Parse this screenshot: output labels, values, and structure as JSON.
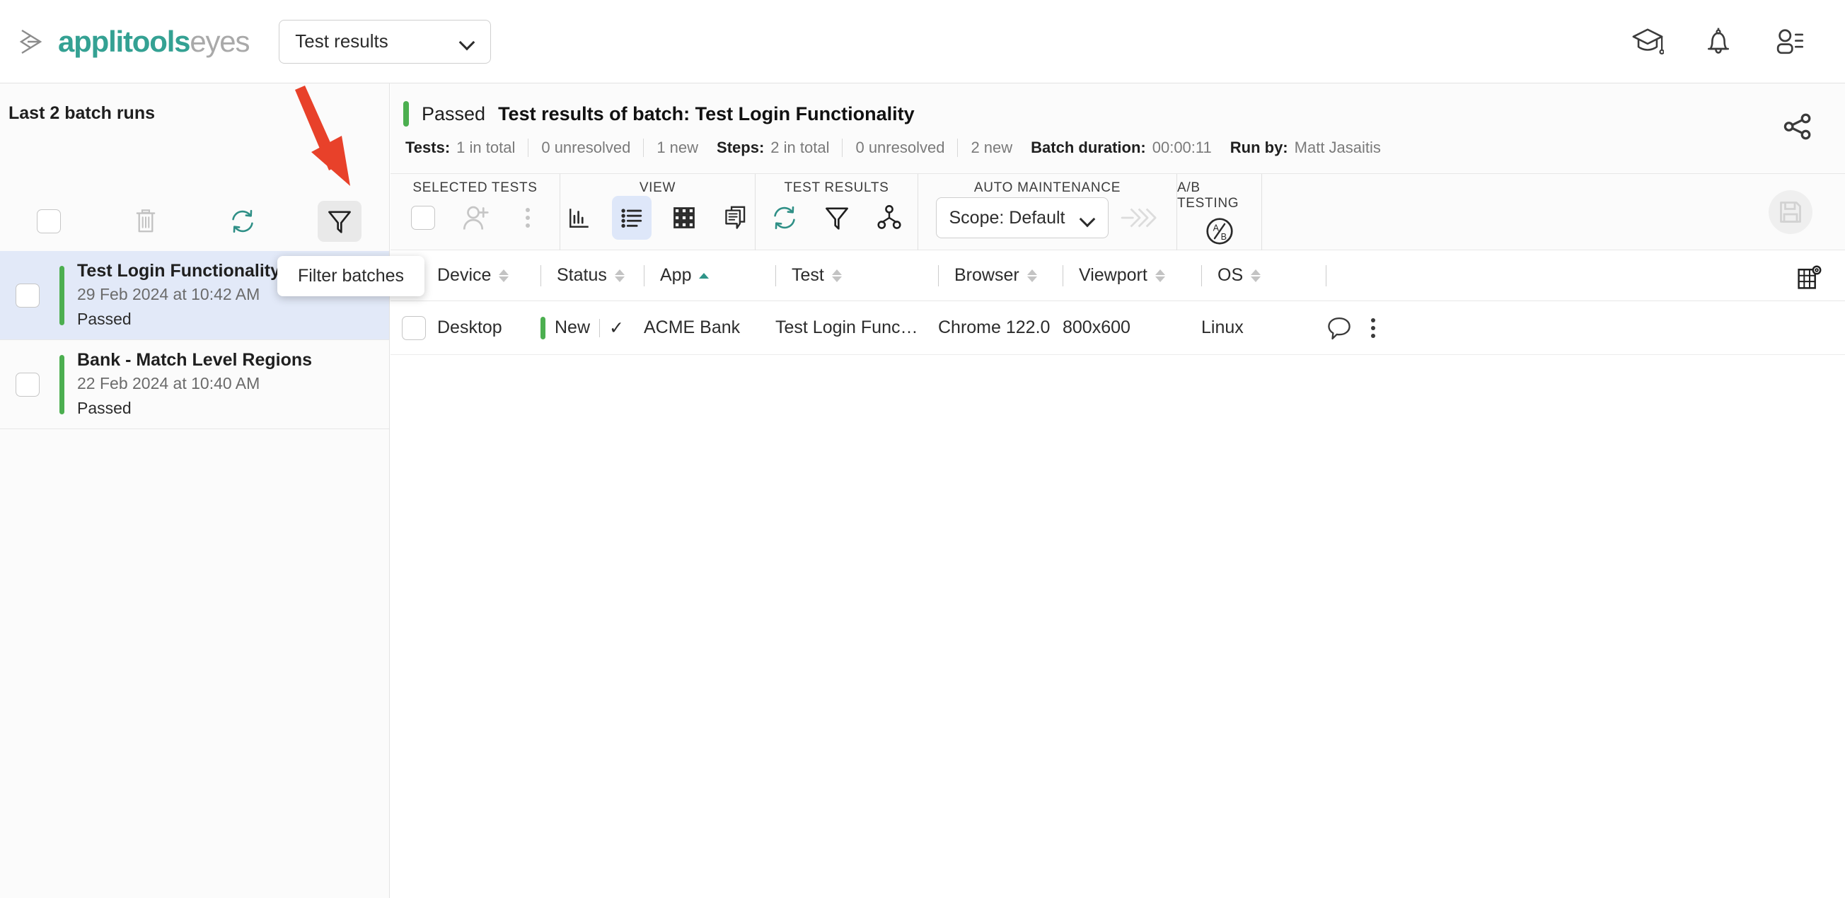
{
  "app": {
    "brand_primary": "applitools",
    "brand_secondary": "eyes",
    "accent_teal": "#34a193",
    "accent_green": "#4caf50",
    "accent_blue": "#dee7f9",
    "annotation_red": "#e8412a"
  },
  "topbar": {
    "product_selector_value": "Test results",
    "icons": [
      {
        "name": "academy-icon",
        "label": "Academy"
      },
      {
        "name": "notifications-icon",
        "label": "Notifications"
      },
      {
        "name": "account-icon",
        "label": "Account"
      }
    ]
  },
  "sidebar": {
    "title": "Last 2 batch runs",
    "tools": [
      {
        "name": "select-all-checkbox",
        "label": "Select all"
      },
      {
        "name": "delete-icon",
        "label": "Delete batches"
      },
      {
        "name": "refresh-icon",
        "label": "Refresh"
      },
      {
        "name": "filter-icon",
        "label": "Filter batches",
        "active": true
      }
    ],
    "batches": [
      {
        "name": "Test Login Functionality",
        "date": "29 Feb 2024 at 10:42 AM",
        "status": "Passed",
        "selected": true
      },
      {
        "name": "Bank - Match Level Regions",
        "date": "22 Feb 2024 at 10:40 AM",
        "status": "Passed",
        "selected": false
      }
    ]
  },
  "tooltip": {
    "text": "Filter batches"
  },
  "batch_header": {
    "status": "Passed",
    "title_label": "Test results of batch:",
    "title_value": "Test Login Functionality",
    "stats": [
      {
        "label": "Tests:",
        "value": "1 in total"
      },
      {
        "label": "",
        "value": "0 unresolved"
      },
      {
        "label": "",
        "value": "1 new"
      },
      {
        "label": "Steps:",
        "value": "2 in total"
      },
      {
        "label": "",
        "value": "0 unresolved"
      },
      {
        "label": "",
        "value": "2 new"
      },
      {
        "label": "Batch duration:",
        "value": "00:00:11"
      },
      {
        "label": "Run by:",
        "value": "Matt Jasaitis"
      }
    ],
    "tests_label": "Tests:",
    "tests_total": "1 in total",
    "tests_unresolved": "0 unresolved",
    "tests_new": "1 new",
    "steps_label": "Steps:",
    "steps_total": "2 in total",
    "steps_unresolved": "0 unresolved",
    "steps_new": "2 new",
    "duration_label": "Batch duration:",
    "duration_value": "00:00:11",
    "runby_label": "Run by:",
    "runby_value": "Matt Jasaitis",
    "share_icon": "share-icon"
  },
  "toolbar": {
    "groups": [
      {
        "label": "SELECTED TESTS",
        "items": [
          {
            "name": "selected-tests-checkbox",
            "icon": "checkbox"
          },
          {
            "name": "assign-user-icon",
            "icon": "user-plus"
          },
          {
            "name": "selected-tests-more-icon",
            "icon": "kebab"
          }
        ]
      },
      {
        "label": "VIEW",
        "items": [
          {
            "name": "view-chart-icon",
            "icon": "bar-chart",
            "active": false
          },
          {
            "name": "view-list-icon",
            "icon": "list",
            "active": true
          },
          {
            "name": "view-grid-icon",
            "icon": "grid",
            "active": false
          },
          {
            "name": "view-batch-icon",
            "icon": "documents",
            "active": false
          }
        ]
      },
      {
        "label": "TEST RESULTS",
        "items": [
          {
            "name": "results-refresh-icon",
            "icon": "refresh"
          },
          {
            "name": "results-filter-icon",
            "icon": "funnel"
          },
          {
            "name": "results-group-icon",
            "icon": "hierarchy"
          }
        ]
      },
      {
        "label": "AUTO MAINTENANCE",
        "scope_value": "Scope: Default",
        "items": [
          {
            "name": "apply-maintenance-icon",
            "icon": "chevrons-right"
          }
        ]
      },
      {
        "label": "A/B TESTING",
        "items": [
          {
            "name": "ab-testing-icon",
            "icon": "ab-circle"
          }
        ]
      }
    ],
    "selected_tests_label": "SELECTED TESTS",
    "view_label": "VIEW",
    "test_results_label": "TEST RESULTS",
    "auto_maintenance_label": "AUTO MAINTENANCE",
    "ab_testing_label": "A/B TESTING",
    "scope_value": "Scope: Default",
    "save_icon": "save-icon"
  },
  "table": {
    "columns": [
      {
        "key": "device",
        "label": "Device",
        "sort": "none"
      },
      {
        "key": "status",
        "label": "Status",
        "sort": "none"
      },
      {
        "key": "app",
        "label": "App",
        "sort": "asc"
      },
      {
        "key": "test",
        "label": "Test",
        "sort": "none"
      },
      {
        "key": "browser",
        "label": "Browser",
        "sort": "none"
      },
      {
        "key": "viewport",
        "label": "Viewport",
        "sort": "none"
      },
      {
        "key": "os",
        "label": "OS",
        "sort": "none"
      }
    ],
    "col_device": "Device",
    "col_status": "Status",
    "col_app": "App",
    "col_test": "Test",
    "col_browser": "Browser",
    "col_viewport": "Viewport",
    "col_os": "OS",
    "settings_icon": "table-settings-icon",
    "rows": [
      {
        "device": "Desktop",
        "status": "New",
        "status_check": "✓",
        "app": "ACME Bank",
        "test": "Test Login Func…",
        "browser": "Chrome 122.0",
        "viewport": "800x600",
        "os": "Linux"
      }
    ],
    "row0": {
      "device": "Desktop",
      "status": "New",
      "status_check": "✓",
      "app": "ACME Bank",
      "test": "Test Login Func…",
      "browser": "Chrome 122.0",
      "viewport": "800x600",
      "os": "Linux"
    }
  }
}
